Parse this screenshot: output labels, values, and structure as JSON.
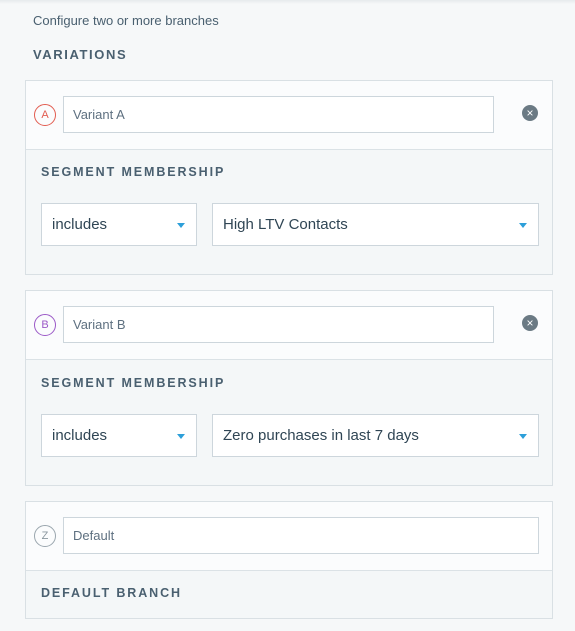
{
  "intro": "Configure two or more branches",
  "variations_title": "VARIATIONS",
  "variants": [
    {
      "badge": "A",
      "name": "Variant A",
      "segment_title": "SEGMENT MEMBERSHIP",
      "operator": "includes",
      "segment": "High LTV Contacts"
    },
    {
      "badge": "B",
      "name": "Variant B",
      "segment_title": "SEGMENT MEMBERSHIP",
      "operator": "includes",
      "segment": "Zero purchases in last 7 days"
    }
  ],
  "default_branch": {
    "badge": "Z",
    "name": "Default",
    "title": "DEFAULT BRANCH"
  },
  "colors": {
    "badge_a": "#e25c50",
    "badge_b": "#9b59c7",
    "badge_z": "#9aa6ae",
    "caret": "#2d9fd9"
  },
  "icons": {
    "remove": "close-circle-icon",
    "dropdown": "chevron-down-icon"
  }
}
